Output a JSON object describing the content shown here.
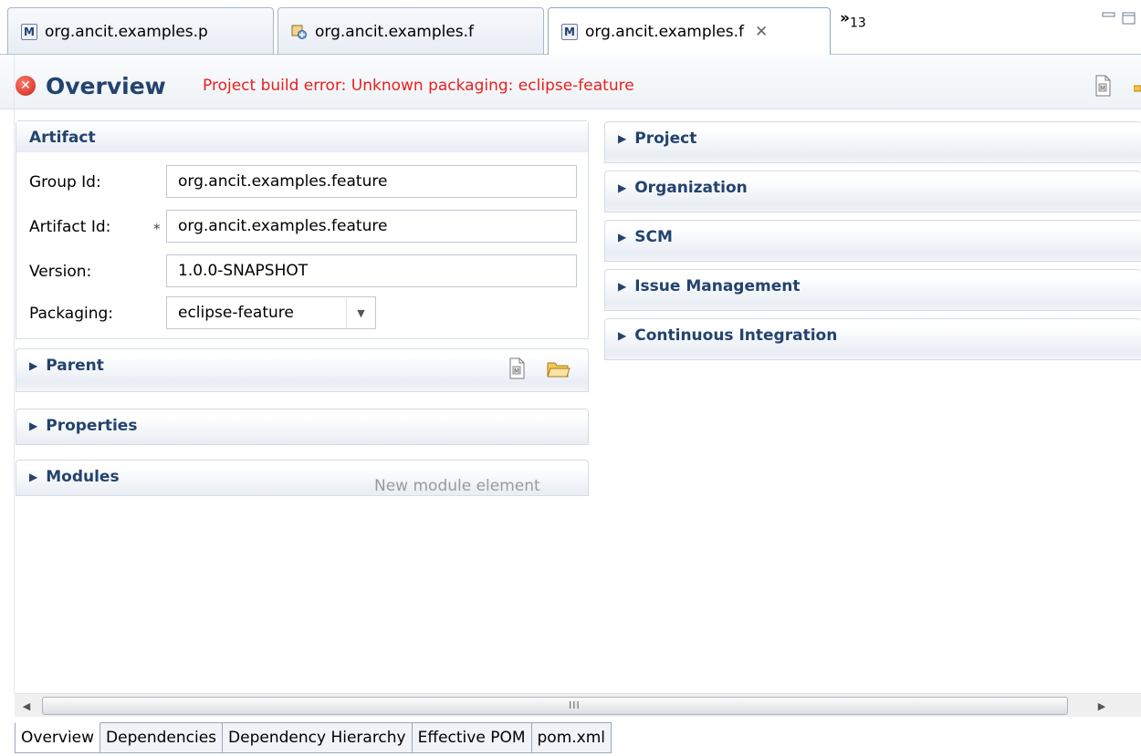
{
  "tabs": [
    {
      "label": "org.ancit.examples.p",
      "icon": "maven-pom-icon"
    },
    {
      "label": "org.ancit.examples.f",
      "icon": "feature-icon"
    },
    {
      "label": "org.ancit.examples.f",
      "icon": "maven-pom-icon",
      "close": "✕"
    }
  ],
  "tab_overflow": {
    "chevron": "»",
    "count": "13"
  },
  "maven_icon_letter": "M",
  "header": {
    "title": "Overview",
    "error_message": "Project build error: Unknown packaging: eclipse-feature"
  },
  "artifact": {
    "title": "Artifact",
    "group_id_label": "Group Id:",
    "group_id": "org.ancit.examples.feature",
    "artifact_id_label": "Artifact Id:",
    "artifact_id_required": "*",
    "artifact_id": "org.ancit.examples.feature",
    "version_label": "Version:",
    "version": "1.0.0-SNAPSHOT",
    "packaging_label": "Packaging:",
    "packaging": "eclipse-feature"
  },
  "sections_left": {
    "parent": "Parent",
    "properties": "Properties",
    "modules": "Modules",
    "modules_hint": "New module element"
  },
  "sections_right": [
    "Project",
    "Organization",
    "SCM",
    "Issue Management",
    "Continuous Integration"
  ],
  "scrollbar": {
    "grip": "III"
  },
  "page_tabs": [
    "Overview",
    "Dependencies",
    "Dependency Hierarchy",
    "Effective POM",
    "pom.xml"
  ],
  "colors": {
    "error": "#e82020",
    "title": "#23436e",
    "section_border": "#d3dce6"
  }
}
